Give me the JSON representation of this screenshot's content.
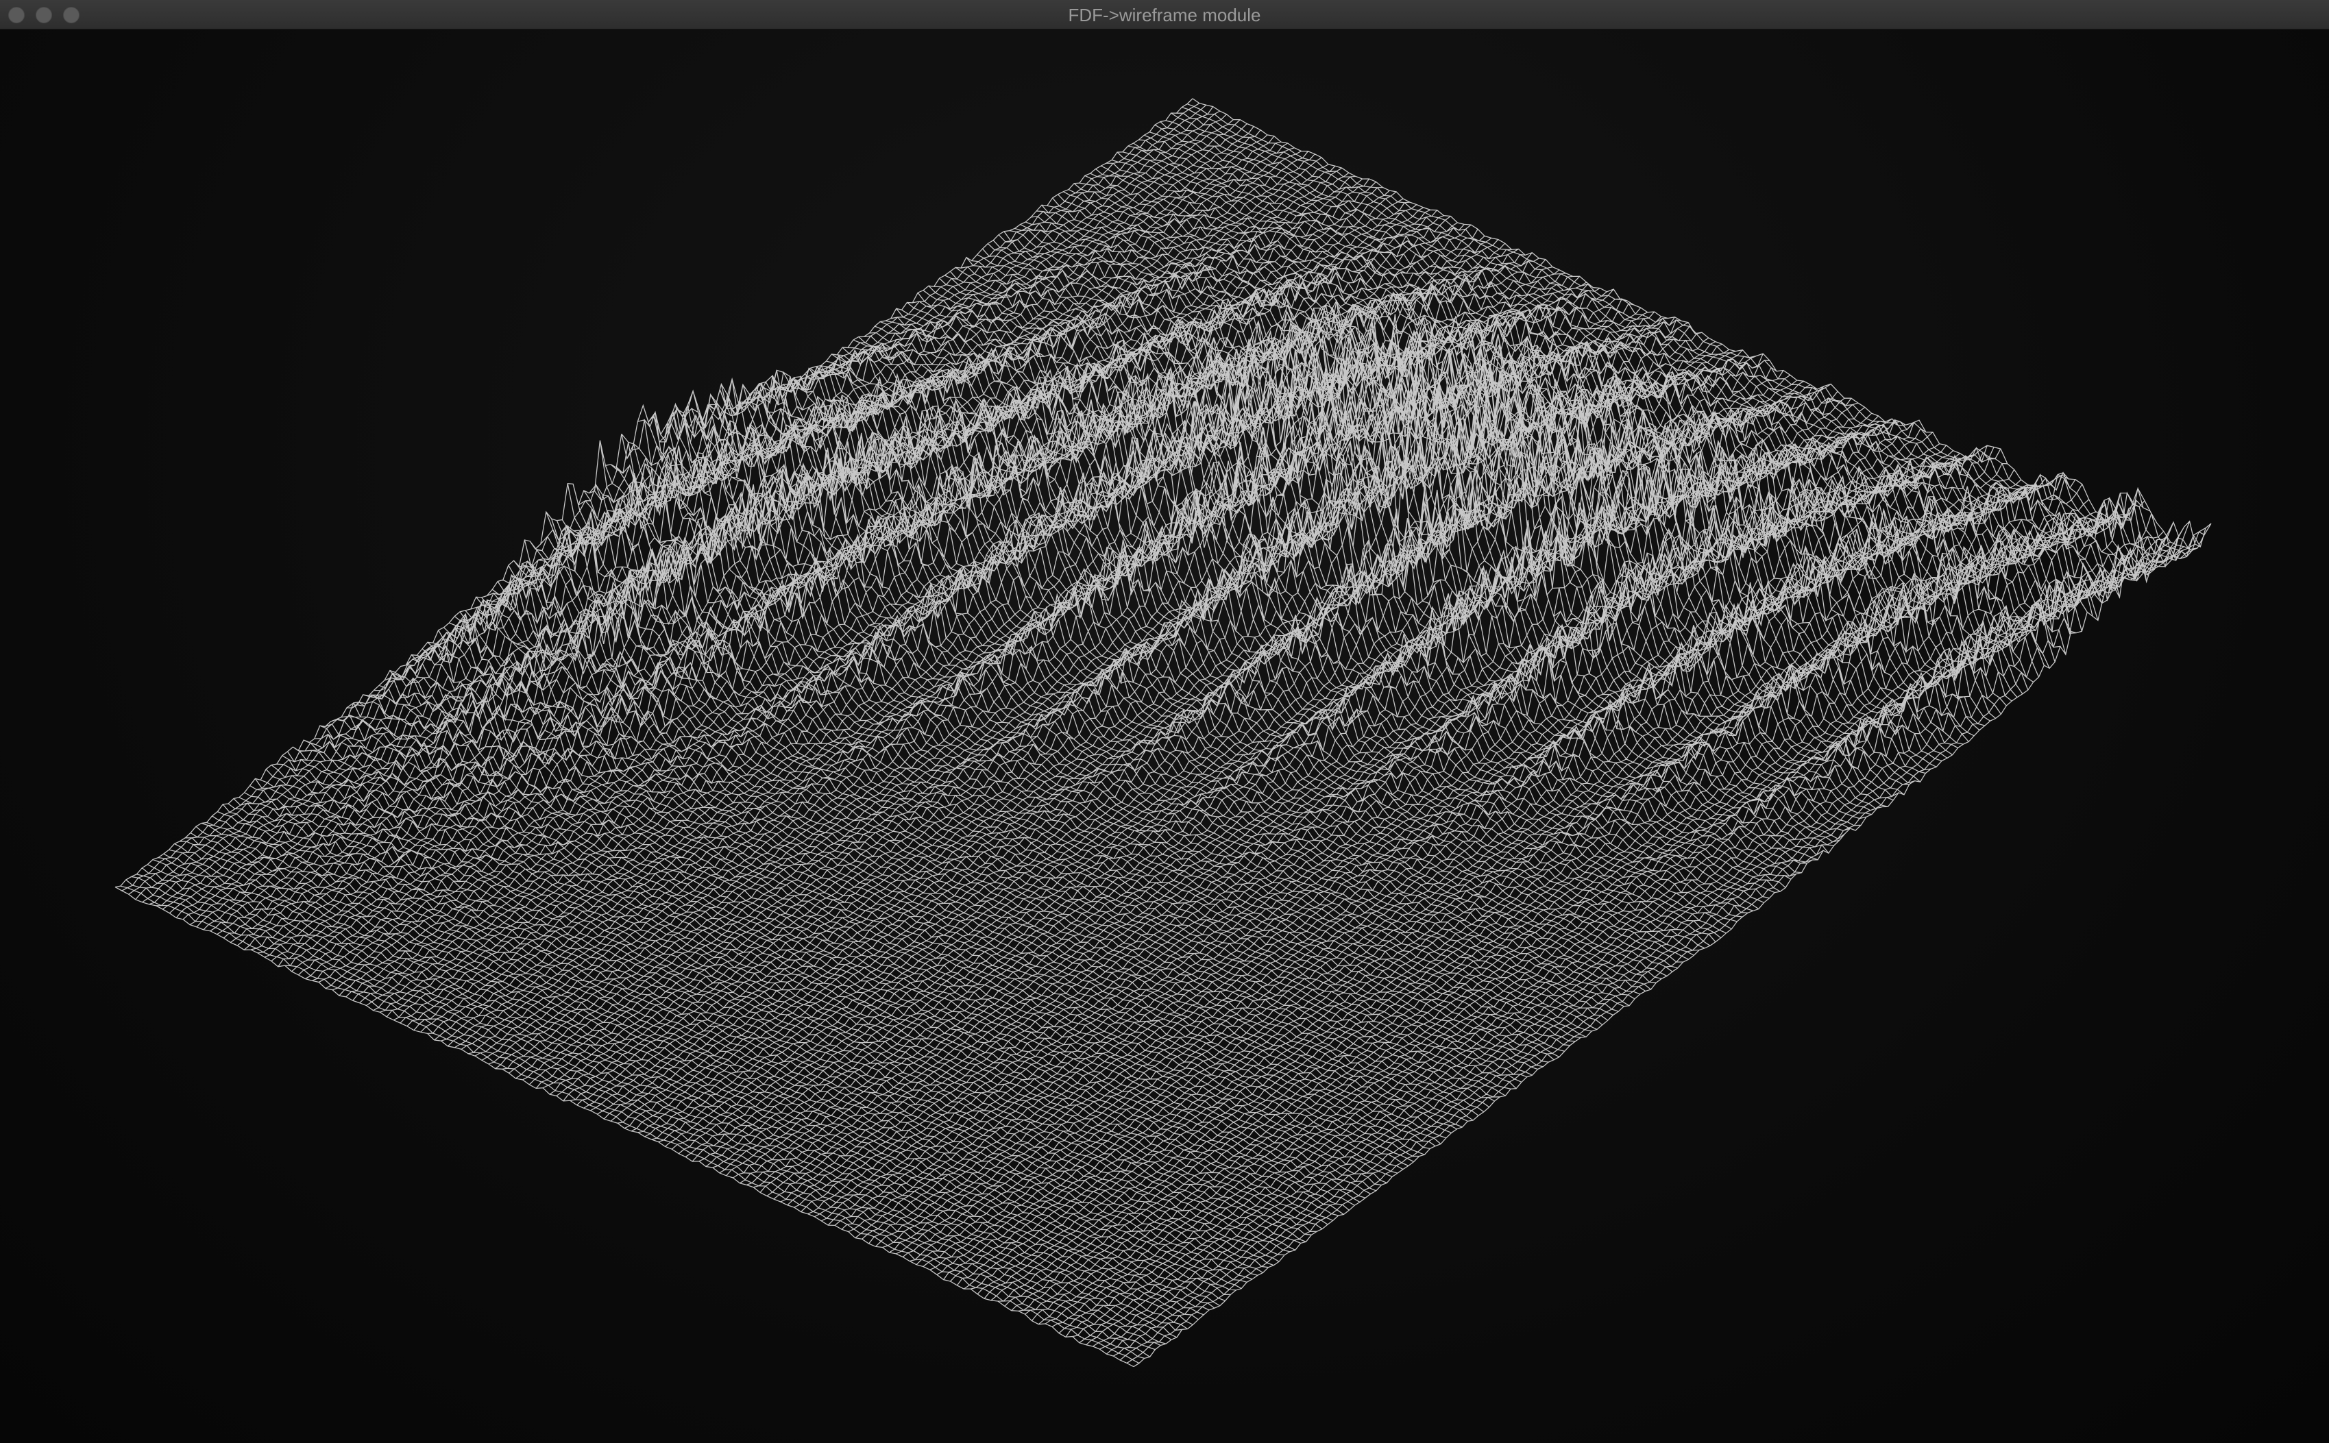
{
  "window": {
    "title": "FDF->wireframe module"
  },
  "colors": {
    "background": "#0c0c0c",
    "wire": "#e8e8e8",
    "titlebar_text": "#9a9a9a"
  },
  "wireframe": {
    "projection": "isometric",
    "terrain": "mountain ridges across a flat plain"
  }
}
